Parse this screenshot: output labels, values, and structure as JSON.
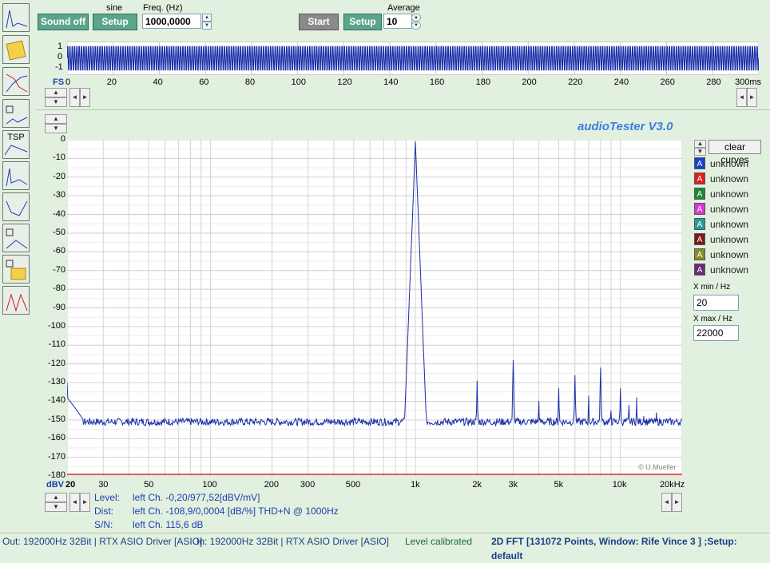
{
  "left_toolbar": [
    "fft-spectrum-icon",
    "notes-icon",
    "frequency-response-icon",
    "speaker-impedance-icon",
    "tsp-icon",
    "distortion-icon",
    "bandwidth-icon",
    "speaker-measure-icon",
    "speaker-notes-icon",
    "oscilloscope-icon"
  ],
  "left_toolbar_tsp_label": "TSP",
  "generator": {
    "sound_label": "Sound off",
    "wave_label": "sine",
    "setup_label": "Setup",
    "freq_label": "Freq. (Hz)",
    "freq_value": "1000,0000"
  },
  "analyzer": {
    "start_label": "Start",
    "setup_label": "Setup",
    "average_label": "Average",
    "average_value": "10"
  },
  "time_plot": {
    "y_ticks": [
      "1",
      "0",
      "-1"
    ],
    "fs_label": "FS",
    "x_ticks": [
      "0",
      "20",
      "40",
      "60",
      "80",
      "100",
      "120",
      "140",
      "160",
      "180",
      "200",
      "220",
      "240",
      "260",
      "280",
      "300ms"
    ]
  },
  "app_title": "audioTester  V3.0",
  "clear_curves_label": "clear curves",
  "legend": [
    {
      "letter": "A",
      "label": "unknown",
      "color": "#1a3fd0"
    },
    {
      "letter": "A",
      "label": "unknown",
      "color": "#e02020"
    },
    {
      "letter": "A",
      "label": "unknown",
      "color": "#1f8a3a"
    },
    {
      "letter": "A",
      "label": "unknown",
      "color": "#d838d8"
    },
    {
      "letter": "A",
      "label": "unknown",
      "color": "#2a9a9a"
    },
    {
      "letter": "A",
      "label": "unknown",
      "color": "#7a1a1a"
    },
    {
      "letter": "A",
      "label": "unknown",
      "color": "#8a8a2a"
    },
    {
      "letter": "A",
      "label": "unknown",
      "color": "#6a2a7a"
    }
  ],
  "xrange": {
    "min_label": "X min / Hz",
    "min_value": "20",
    "max_label": "X max / Hz",
    "max_value": "22000"
  },
  "copyright": "© U.Mueller",
  "chart_data": {
    "type": "line",
    "ylabel": "dBV",
    "x_scale": "log",
    "xlim": [
      20,
      20000
    ],
    "ylim": [
      -180,
      0
    ],
    "y_ticks": [
      "0",
      "-10",
      "-20",
      "-30",
      "-40",
      "-50",
      "-60",
      "-70",
      "-80",
      "-90",
      "-100",
      "-110",
      "-120",
      "-130",
      "-140",
      "-150",
      "-160",
      "-170",
      "-180"
    ],
    "x_ticks": [
      {
        "v": 20,
        "label": "20"
      },
      {
        "v": 30,
        "label": "30"
      },
      {
        "v": 50,
        "label": "50"
      },
      {
        "v": 100,
        "label": "100"
      },
      {
        "v": 200,
        "label": "200"
      },
      {
        "v": 300,
        "label": "300"
      },
      {
        "v": 500,
        "label": "500"
      },
      {
        "v": 1000,
        "label": "1k"
      },
      {
        "v": 2000,
        "label": "2k"
      },
      {
        "v": 3000,
        "label": "3k"
      },
      {
        "v": 5000,
        "label": "5k"
      },
      {
        "v": 10000,
        "label": "10k"
      },
      {
        "v": 20000,
        "label": "20kHz"
      }
    ],
    "series": [
      {
        "color": "#1a2fa8",
        "noise_floor_db": -151,
        "peaks": [
          {
            "f": 20,
            "db": -130
          },
          {
            "f": 1000,
            "db": -1
          },
          {
            "f": 2000,
            "db": -129
          },
          {
            "f": 3000,
            "db": -118
          },
          {
            "f": 4000,
            "db": -140
          },
          {
            "f": 5000,
            "db": -133
          },
          {
            "f": 6000,
            "db": -126
          },
          {
            "f": 7000,
            "db": -137
          },
          {
            "f": 8000,
            "db": -122
          },
          {
            "f": 9000,
            "db": -145
          },
          {
            "f": 10000,
            "db": -133
          },
          {
            "f": 11000,
            "db": -142
          },
          {
            "f": 12000,
            "db": -138
          },
          {
            "f": 13000,
            "db": -148
          },
          {
            "f": 15000,
            "db": -146
          }
        ]
      }
    ]
  },
  "info": {
    "level_label": "Level:",
    "level_value": "left Ch. -0,20/977,52[dBV/mV]",
    "dist_label": "Dist:",
    "dist_value": "left Ch. -108,9/0,0004 [dB/%] THD+N  @ 1000Hz",
    "sn_label": "S/N:",
    "sn_value": "left Ch. 115,6 dB"
  },
  "status": {
    "out": "Out: 192000Hz 32Bit  | RTX ASIO Driver [ASIO]",
    "in": "In: 192000Hz 32Bit  | RTX ASIO Driver [ASIO]",
    "level": "Level calibrated",
    "fft": "2D FFT [131072 Points, Window: Rife Vince 3 ]  ;Setup:  default"
  }
}
